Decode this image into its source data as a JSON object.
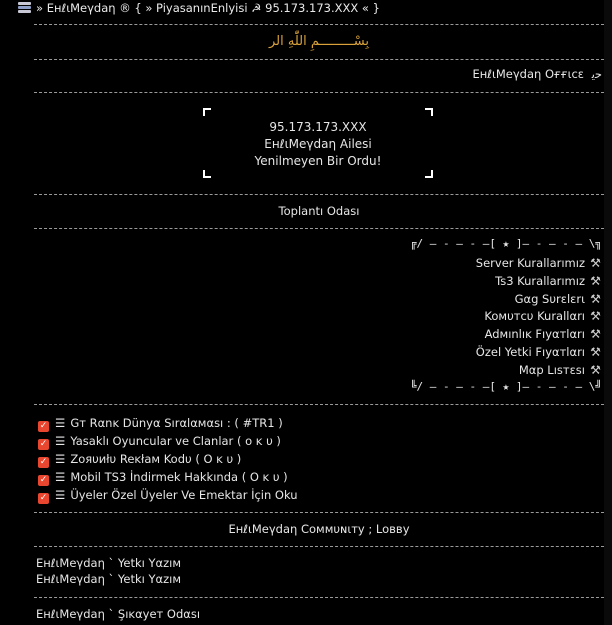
{
  "title_bar": {
    "text": "» EнℓιMeγdaη ® { » PiyasanınEnlyisi ☭ 95.173.173.XXX « }"
  },
  "bismillah": "بِسْـــــــــمِ اللّٰهِ الر",
  "office": {
    "label": "EнℓιMeγdaη Oғғιcε",
    "symbol": "ﺣﻳ"
  },
  "banner": {
    "line1": "95.173.173.XXX",
    "line2": "EнℓιMeγdaη Ailesi",
    "line3": "Yenilmeyen Bir Ordu!"
  },
  "meeting_room": "Toplantı Odası",
  "frame": {
    "top": "╔/ — - — - —[ ★ ]— - — - — \\╗",
    "bottom": "╚/ — - — - —[ ★ ]— - — - — \\╝"
  },
  "rules_menu": [
    {
      "label": "Server Kurallarımız"
    },
    {
      "label": "Ts3 Kurallarımız"
    },
    {
      "label": "Gαg Sυrεlεrι"
    },
    {
      "label": "Koмυтcυ Kurallαrı"
    },
    {
      "label": "Adмınlıĸ Fıyαтlαrı"
    },
    {
      "label": "Özel Yetki Fıyαтlαrı"
    },
    {
      "label": "Mαp Lısтεsı"
    }
  ],
  "checklist": [
    {
      "label": "Gт Rαnĸ Dünyα Sırαlαмαsı : ( #TR1 )"
    },
    {
      "label": "Yasaklı Oyuncular ve Clanlar ( o ĸ υ )"
    },
    {
      "label": "Zoяυиłυ Reĸłaм Kodυ ( O ĸ υ )"
    },
    {
      "label": "Mobil TS3 İndirmek Hakkında ( O ĸ υ )"
    },
    {
      "label": "Üyeler Özel Üyeler Ve Emektar İçin Oku"
    }
  ],
  "community_lobby": "EнℓιMeγdaη Coммυɴιтy ; Loввy",
  "channels": [
    {
      "label": "EнℓιMeγdaη ` Yetkı Yαzıм"
    },
    {
      "label": "EнℓιMeγdaη ` Yetkı Yαzıм"
    },
    {
      "label": "EнℓιMeγdaη ` Şıĸαyeт Odαsı"
    }
  ]
}
